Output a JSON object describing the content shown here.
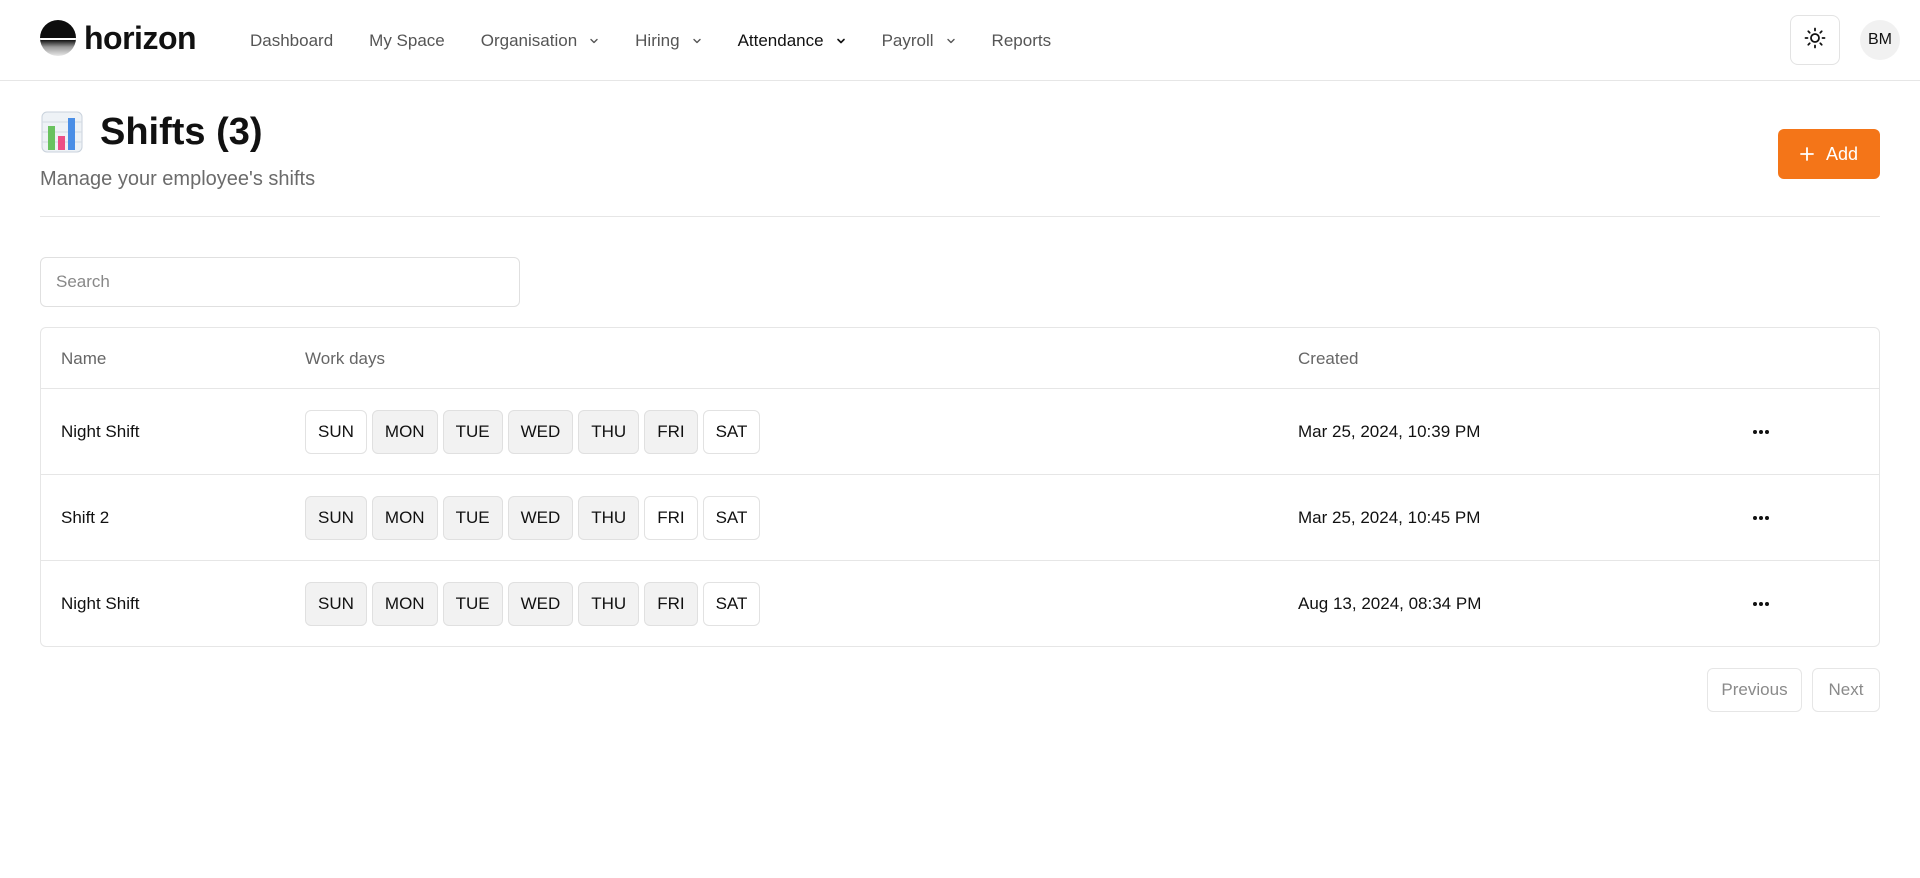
{
  "brand": {
    "name": "horizon"
  },
  "nav": {
    "items": [
      {
        "label": "Dashboard",
        "dropdown": false,
        "active": false
      },
      {
        "label": "My Space",
        "dropdown": false,
        "active": false
      },
      {
        "label": "Organisation",
        "dropdown": true,
        "active": false
      },
      {
        "label": "Hiring",
        "dropdown": true,
        "active": false
      },
      {
        "label": "Attendance",
        "dropdown": true,
        "active": true
      },
      {
        "label": "Payroll",
        "dropdown": true,
        "active": false
      },
      {
        "label": "Reports",
        "dropdown": false,
        "active": false
      }
    ]
  },
  "header_actions": {
    "theme_icon": "sun-icon",
    "avatar_initials": "BM"
  },
  "page": {
    "title": "Shifts (3)",
    "subtitle": "Manage your employee's shifts",
    "title_icon": "bar-chart-icon",
    "add_label": "Add"
  },
  "search": {
    "placeholder": "Search",
    "value": ""
  },
  "table": {
    "columns": [
      "Name",
      "Work days",
      "Created"
    ],
    "rows": [
      {
        "name": "Night Shift",
        "created": "Mar 25, 2024, 10:39 PM",
        "days": [
          {
            "label": "SUN",
            "active": false
          },
          {
            "label": "MON",
            "active": true
          },
          {
            "label": "TUE",
            "active": true
          },
          {
            "label": "WED",
            "active": true
          },
          {
            "label": "THU",
            "active": true
          },
          {
            "label": "FRI",
            "active": true
          },
          {
            "label": "SAT",
            "active": false
          }
        ]
      },
      {
        "name": "Shift 2",
        "created": "Mar 25, 2024, 10:45 PM",
        "days": [
          {
            "label": "SUN",
            "active": true
          },
          {
            "label": "MON",
            "active": true
          },
          {
            "label": "TUE",
            "active": true
          },
          {
            "label": "WED",
            "active": true
          },
          {
            "label": "THU",
            "active": true
          },
          {
            "label": "FRI",
            "active": false
          },
          {
            "label": "SAT",
            "active": false
          }
        ]
      },
      {
        "name": "Night Shift",
        "created": "Aug 13, 2024, 08:34 PM",
        "days": [
          {
            "label": "SUN",
            "active": true
          },
          {
            "label": "MON",
            "active": true
          },
          {
            "label": "TUE",
            "active": true
          },
          {
            "label": "WED",
            "active": true
          },
          {
            "label": "THU",
            "active": true
          },
          {
            "label": "FRI",
            "active": true
          },
          {
            "label": "SAT",
            "active": false
          }
        ]
      }
    ]
  },
  "pagination": {
    "previous": "Previous",
    "next": "Next"
  },
  "colors": {
    "accent": "#f47518",
    "active_day_bg": "#f2f2f2",
    "border": "#e6e6e6"
  }
}
